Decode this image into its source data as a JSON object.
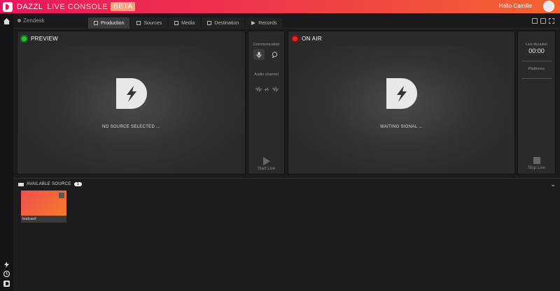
{
  "app": {
    "brand": "DAZZL",
    "subtitle": "LIVE CONSOLE",
    "badge": "BETA",
    "greeting": "Hello Camille",
    "workspace": "Zendesk"
  },
  "tabs": [
    {
      "label": "Production",
      "icon": "production-icon",
      "active": true
    },
    {
      "label": "Sources",
      "icon": "sources-icon",
      "active": false
    },
    {
      "label": "Media",
      "icon": "media-icon",
      "active": false
    },
    {
      "label": "Destination",
      "icon": "destination-icon",
      "active": false
    },
    {
      "label": "Records",
      "icon": "records-icon",
      "active": false
    }
  ],
  "preview": {
    "title": "PREVIEW",
    "message": "NO SOURCE SELECTED ...",
    "status_color": "#2cc531"
  },
  "onair": {
    "title": "ON AIR",
    "message": "WAITING SIGNAL ...",
    "status_color": "#e02a2a"
  },
  "controls": {
    "communication_label": "Communication",
    "audio_label": "Audio channel",
    "start_label": "Start Live"
  },
  "live": {
    "duration_label": "Live duration",
    "duration_value": "00:00",
    "platforms_label": "Platforms",
    "stop_label": "Stop Live"
  },
  "sources": {
    "header": "AVAILABLE SOURCE",
    "count": "1",
    "items": [
      {
        "label": "testcard"
      }
    ]
  },
  "colors": {
    "topbar_start": "#e8175d",
    "topbar_end": "#f2652e",
    "accent_beta": "#f7a27a"
  }
}
